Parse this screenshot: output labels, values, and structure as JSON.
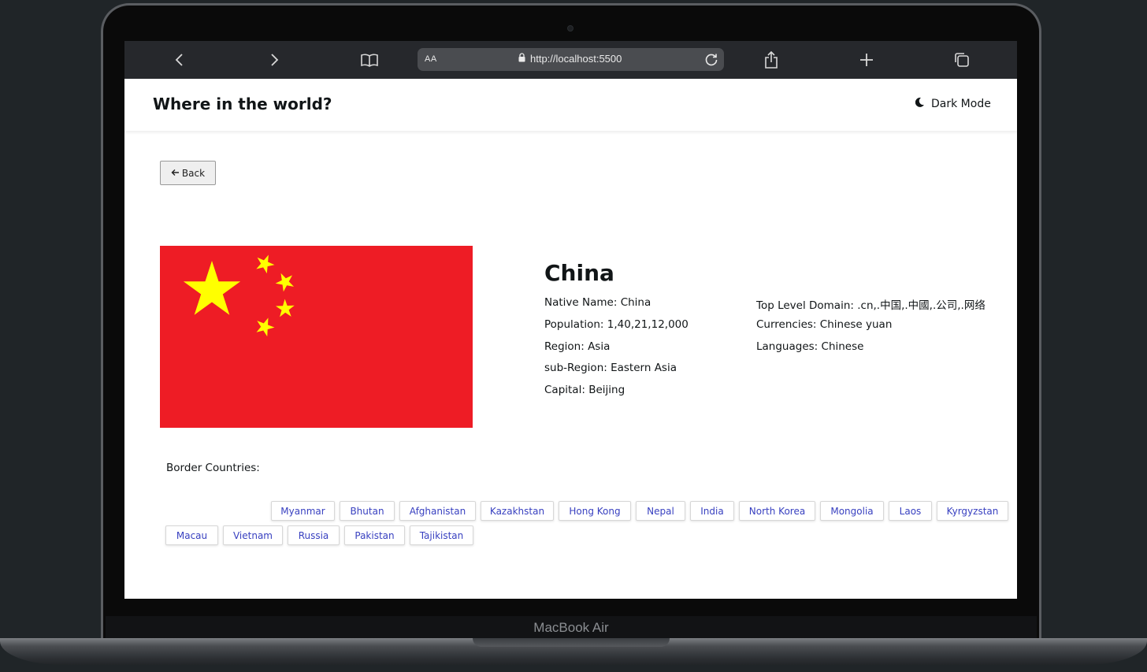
{
  "browser": {
    "text_size_label": "AA",
    "url": "http://localhost:5500"
  },
  "device": {
    "label": "MacBook Air"
  },
  "header": {
    "title": "Where in the world?",
    "dark_mode_label": "Dark Mode"
  },
  "back_button": {
    "label": "Back"
  },
  "country": {
    "name": "China",
    "details_left": [
      {
        "key": "Native Name:",
        "value": "China"
      },
      {
        "key": "Population:",
        "value": "1,40,21,12,000"
      },
      {
        "key": "Region:",
        "value": "Asia"
      },
      {
        "key": "sub-Region:",
        "value": "Eastern Asia"
      },
      {
        "key": "Capital:",
        "value": "Beijing"
      }
    ],
    "details_right": [
      {
        "key": "Top Level Domain:",
        "value": ".cn,.中国,.中國,.公司,.网络"
      },
      {
        "key": "Currencies:",
        "value": "Chinese yuan"
      },
      {
        "key": "Languages:",
        "value": "Chinese"
      }
    ],
    "flag": {
      "field_color": "#ee1c25",
      "star_color": "#ffff00"
    },
    "border_label": "Border Countries:",
    "borders": [
      "Myanmar",
      "Bhutan",
      "Afghanistan",
      "Kazakhstan",
      "Hong Kong",
      "Nepal",
      "India",
      "North Korea",
      "Mongolia",
      "Laos",
      "Kyrgyzstan",
      "Macau",
      "Vietnam",
      "Russia",
      "Pakistan",
      "Tajikistan"
    ]
  }
}
